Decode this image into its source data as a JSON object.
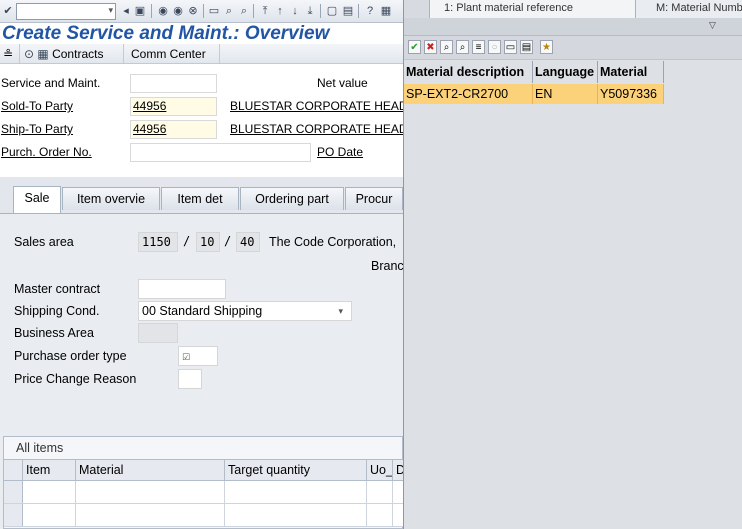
{
  "sap": {
    "title": "Create Service and Maint.: Overview",
    "appbar": {
      "contracts_label": "Contracts",
      "comm_center_label": "Comm Center"
    },
    "header": {
      "doc_type_label": "Service and Maint.",
      "net_value_label": "Net value",
      "sold_to_label": "Sold-To Party",
      "sold_to_value": "44956",
      "sold_to_name": "BLUESTAR CORPORATE HEAD",
      "ship_to_label": "Ship-To Party",
      "ship_to_value": "44956",
      "ship_to_name": "BLUESTAR CORPORATE HEAD",
      "po_label": "Purch. Order No.",
      "po_date_label": "PO Date"
    },
    "tabs": [
      {
        "label": "Sale",
        "active": true
      },
      {
        "label": "Item overvie"
      },
      {
        "label": "Item det"
      },
      {
        "label": "Ordering part"
      },
      {
        "label": "Procur"
      }
    ],
    "sale": {
      "sales_area_label": "Sales area",
      "sales_org": "1150",
      "dist_channel": "10",
      "division": "40",
      "sep": "/",
      "sales_area_desc": "The Code Corporation,",
      "sales_area_desc2": "Branc",
      "master_contract_label": "Master contract",
      "shipping_cond_label": "Shipping Cond.",
      "shipping_cond_value": "00 Standard Shipping",
      "business_area_label": "Business Area",
      "po_type_label": "Purchase order type",
      "price_change_label": "Price Change Reason"
    },
    "items": {
      "caption": "All items",
      "columns": [
        "Item",
        "Material",
        "Target quantity",
        "Uo_",
        "D"
      ]
    }
  },
  "popup": {
    "tabs": [
      "1: Plant material reference",
      "M: Material Number"
    ],
    "columns": [
      "Material description",
      "Language",
      "Material"
    ],
    "rows": [
      {
        "description": "SP-EXT2-CR2700",
        "language": "EN",
        "material": "Y5097336"
      }
    ]
  },
  "colors": {
    "title_blue": "#2255a4",
    "selected_row": "#fbd17a",
    "required_field": "#fffbe5"
  }
}
